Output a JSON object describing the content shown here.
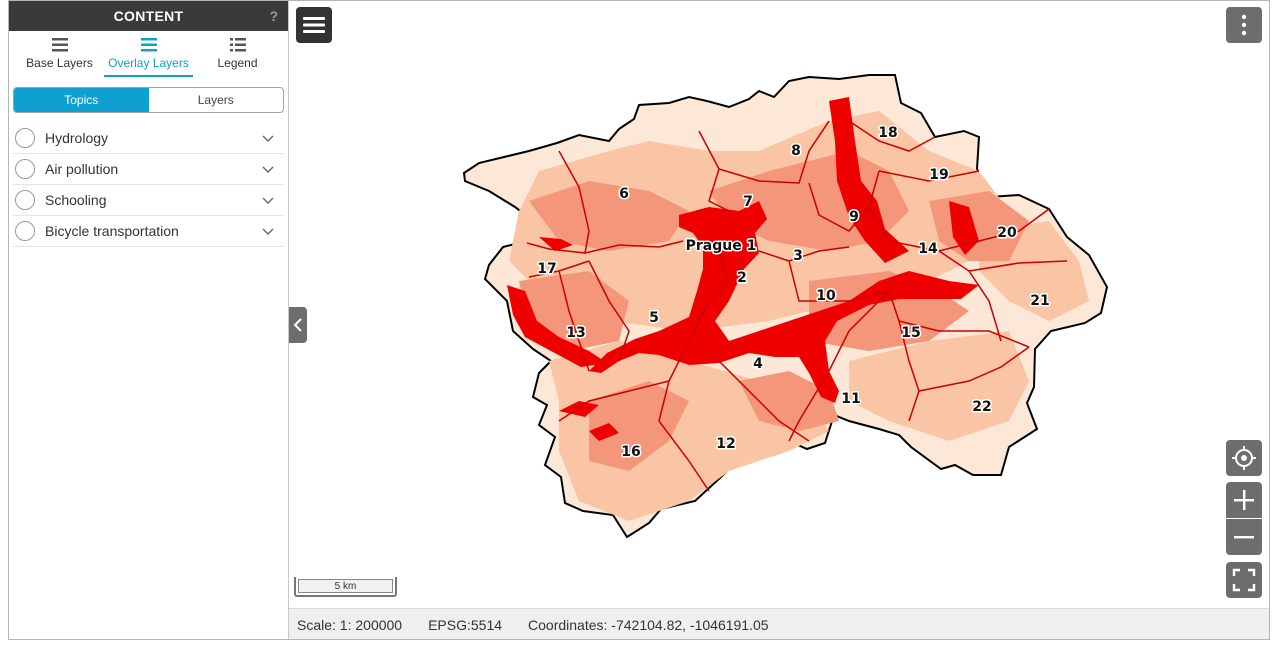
{
  "panel": {
    "title": "CONTENT",
    "help": "?",
    "tabs": [
      {
        "label": "Base Layers",
        "icon": "base-layers-icon"
      },
      {
        "label": "Overlay Layers",
        "icon": "overlay-layers-icon",
        "active": true
      },
      {
        "label": "Legend",
        "icon": "legend-icon"
      }
    ],
    "switch": [
      {
        "label": "Topics",
        "active": true
      },
      {
        "label": "Layers"
      }
    ],
    "topics": [
      {
        "label": "Hydrology"
      },
      {
        "label": "Air pollution"
      },
      {
        "label": "Schooling"
      },
      {
        "label": "Bicycle transportation"
      }
    ]
  },
  "map": {
    "district_labels": [
      "Prague 1",
      "2",
      "3",
      "4",
      "5",
      "6",
      "7",
      "8",
      "9",
      "10",
      "11",
      "12",
      "13",
      "14",
      "15",
      "16",
      "17",
      "18",
      "19",
      "20",
      "21",
      "22"
    ],
    "scale_bar": "5 km",
    "colors": {
      "low": "#fde8d8",
      "medium_low": "#f9c5a4",
      "medium": "#f4967a",
      "high": "#ee0000",
      "border": "#cc0000",
      "outline": "#000000"
    }
  },
  "status": {
    "scale": "Scale: 1: 200000",
    "epsg": "EPSG:5514",
    "coordinates": "Coordinates: -742104.82, -1046191.05"
  }
}
